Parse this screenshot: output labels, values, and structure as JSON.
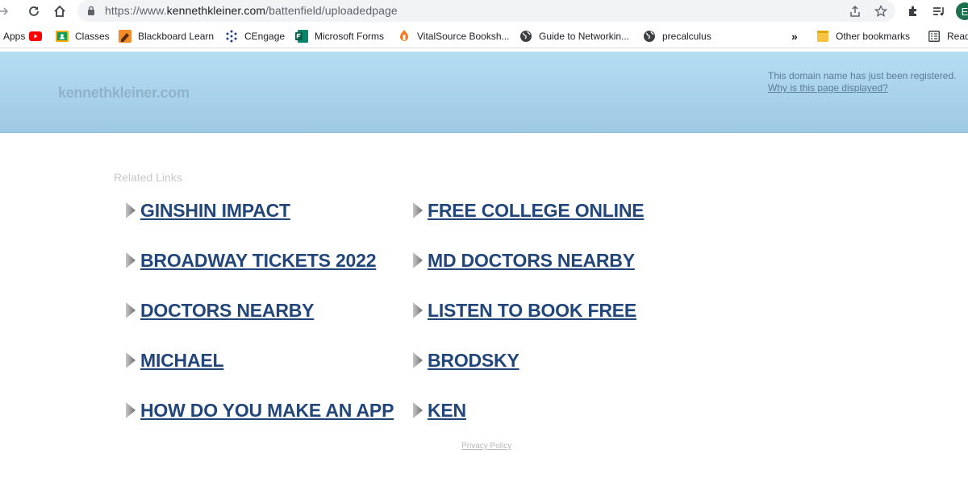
{
  "browser": {
    "url_prefix": "https://www.",
    "url_host": "kennethkleiner.com",
    "url_path": "/battenfield/uploadedpage",
    "avatar_letter": "E",
    "bookmarks": [
      {
        "label": "Apps",
        "icon": "apps-grid-icon"
      },
      {
        "label": "",
        "icon": "youtube-icon"
      },
      {
        "label": "Classes",
        "icon": "google-classroom-icon"
      },
      {
        "label": "Blackboard Learn",
        "icon": "blackboard-icon"
      },
      {
        "label": "CEngage",
        "icon": "cengage-icon"
      },
      {
        "label": "Microsoft Forms",
        "icon": "microsoft-forms-icon"
      },
      {
        "label": "VitalSource Booksh...",
        "icon": "vitalsource-icon"
      },
      {
        "label": "Guide to Networkin...",
        "icon": "globe-icon"
      },
      {
        "label": "precalculus",
        "icon": "globe-icon"
      }
    ],
    "overflow_label": "»",
    "other_bookmarks": "Other bookmarks",
    "reading_list": "Reading list"
  },
  "page": {
    "site_name": "kennethkleiner.com",
    "notice_text": "This domain name has just been registered.",
    "notice_link": "Why is this page displayed?",
    "related_title": "Related Links",
    "links_left": [
      "GINSHIN IMPACT",
      "BROADWAY TICKETS 2022",
      "DOCTORS NEARBY",
      "MICHAEL",
      "HOW DO YOU MAKE AN APP"
    ],
    "links_right": [
      "FREE COLLEGE ONLINE",
      "MD DOCTORS NEARBY",
      "LISTEN TO BOOK FREE",
      "BRODSKY",
      "KEN"
    ],
    "privacy": "Privacy Policy"
  },
  "colors": {
    "banner": "#aed6ee",
    "link": "#22467a",
    "arrow": "#8a8a8a"
  }
}
